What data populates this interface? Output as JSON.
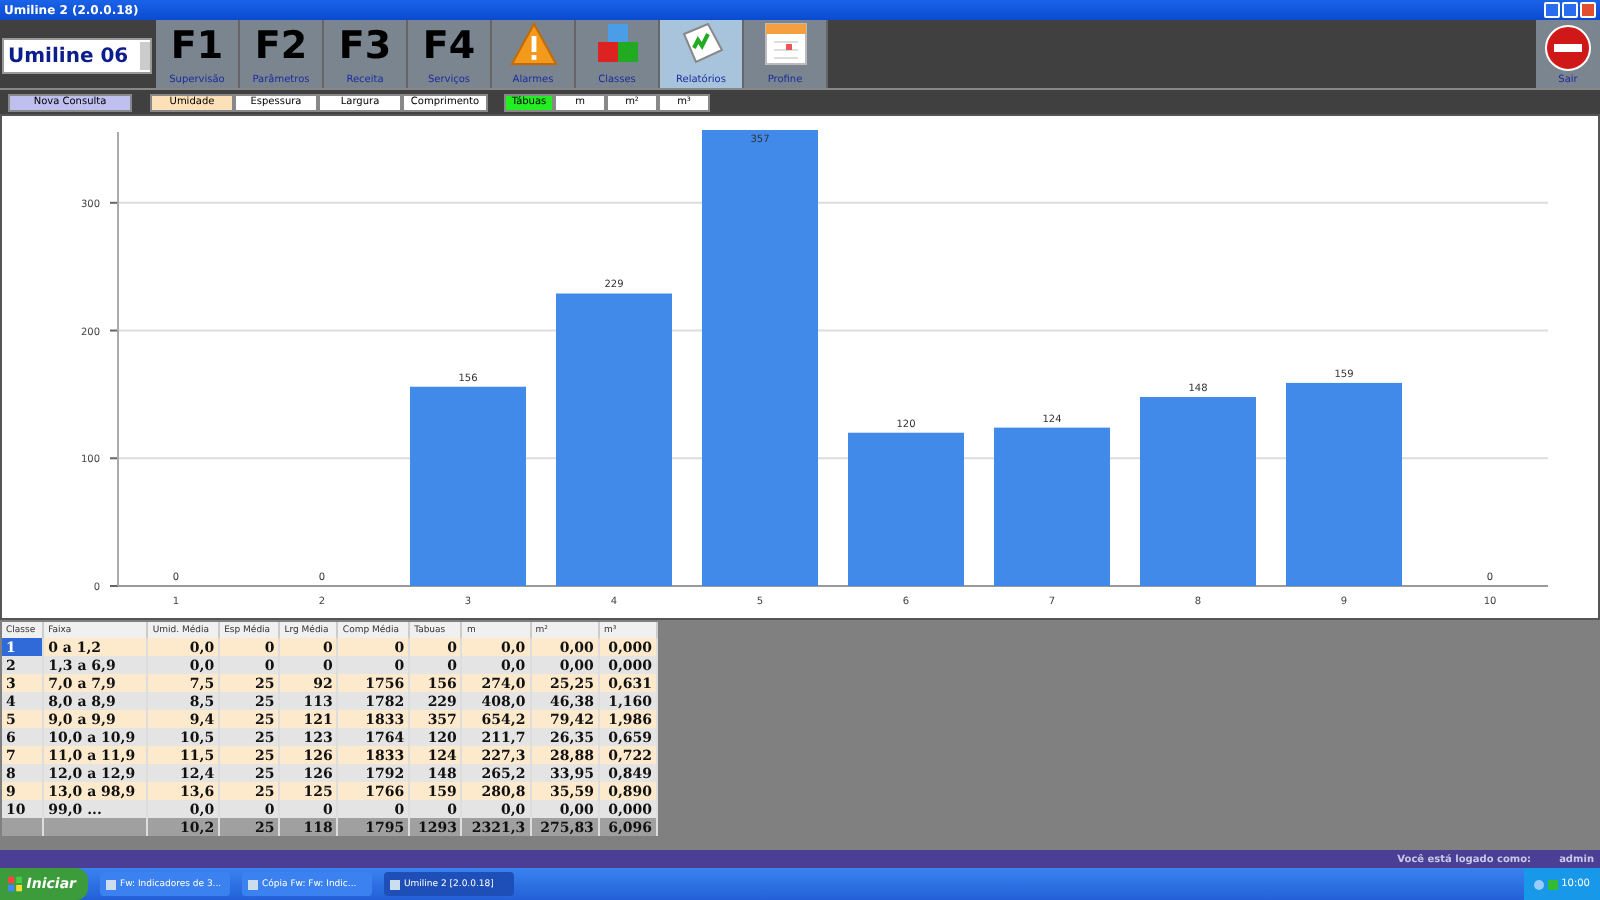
{
  "window": {
    "title": "Umiline 2 (2.0.0.18)"
  },
  "machine": {
    "value": "Umiline 06"
  },
  "toolbar": [
    {
      "kind": "key",
      "key": "F1",
      "label": "Supervisão",
      "selected": false
    },
    {
      "kind": "key",
      "key": "F2",
      "label": "Parâmetros",
      "selected": false
    },
    {
      "kind": "key",
      "key": "F3",
      "label": "Receita",
      "selected": false
    },
    {
      "kind": "key",
      "key": "F4",
      "label": "Serviços",
      "selected": false
    },
    {
      "kind": "warning",
      "label": "Alarmes",
      "selected": false
    },
    {
      "kind": "cubes",
      "label": "Classes",
      "selected": false
    },
    {
      "kind": "report",
      "label": "Relatórios",
      "selected": true
    },
    {
      "kind": "calendar",
      "label": "Profine",
      "selected": false
    }
  ],
  "exit_button": {
    "label": "Sair"
  },
  "new_query": "Nova Consulta",
  "measures": [
    {
      "label": "Umidade",
      "selected": true
    },
    {
      "label": "Espessura",
      "selected": false
    },
    {
      "label": "Largura",
      "selected": false
    },
    {
      "label": "Comprimento",
      "selected": false
    }
  ],
  "units": [
    {
      "label": "Tábuas",
      "selected": true
    },
    {
      "label": "m",
      "selected": false
    },
    {
      "label": "m²",
      "selected": false
    },
    {
      "label": "m³",
      "selected": false
    }
  ],
  "chart_data": {
    "type": "bar",
    "categories": [
      "1",
      "2",
      "3",
      "4",
      "5",
      "6",
      "7",
      "8",
      "9",
      "10"
    ],
    "series": [
      {
        "color": "#418aea",
        "values": [
          0,
          0,
          156,
          229,
          357,
          120,
          124,
          148,
          159,
          0
        ]
      }
    ],
    "ylim": [
      0,
      357
    ],
    "grid": true,
    "yticks": [
      0,
      100,
      200,
      300
    ],
    "data_labels": true
  },
  "table": {
    "columns": [
      "Classe",
      "Faixa",
      "Umid. Média",
      "Esp Média",
      "Lrg Média",
      "Comp Média",
      "Tabuas",
      "m",
      "m²",
      "m³"
    ],
    "rows": [
      {
        "selected": true,
        "cells": [
          "1",
          "0 a 1,2",
          "0,0",
          "0",
          "0",
          "0",
          "0",
          "0,0",
          "0,00",
          "0,000"
        ]
      },
      {
        "selected": false,
        "cells": [
          "2",
          "1,3 a 6,9",
          "0,0",
          "0",
          "0",
          "0",
          "0",
          "0,0",
          "0,00",
          "0,000"
        ]
      },
      {
        "selected": false,
        "cells": [
          "3",
          "7,0 a 7,9",
          "7,5",
          "25",
          "92",
          "1756",
          "156",
          "274,0",
          "25,25",
          "0,631"
        ]
      },
      {
        "selected": false,
        "cells": [
          "4",
          "8,0 a 8,9",
          "8,5",
          "25",
          "113",
          "1782",
          "229",
          "408,0",
          "46,38",
          "1,160"
        ]
      },
      {
        "selected": false,
        "cells": [
          "5",
          "9,0 a 9,9",
          "9,4",
          "25",
          "121",
          "1833",
          "357",
          "654,2",
          "79,42",
          "1,986"
        ]
      },
      {
        "selected": false,
        "cells": [
          "6",
          "10,0 a 10,9",
          "10,5",
          "25",
          "123",
          "1764",
          "120",
          "211,7",
          "26,35",
          "0,659"
        ]
      },
      {
        "selected": false,
        "cells": [
          "7",
          "11,0 a 11,9",
          "11,5",
          "25",
          "126",
          "1833",
          "124",
          "227,3",
          "28,88",
          "0,722"
        ]
      },
      {
        "selected": false,
        "cells": [
          "8",
          "12,0 a 12,9",
          "12,4",
          "25",
          "126",
          "1792",
          "148",
          "265,2",
          "33,95",
          "0,849"
        ]
      },
      {
        "selected": false,
        "cells": [
          "9",
          "13,0 a 98,9",
          "13,6",
          "25",
          "125",
          "1766",
          "159",
          "280,8",
          "35,59",
          "0,890"
        ]
      },
      {
        "selected": false,
        "cells": [
          "10",
          "99,0 ...",
          "0,0",
          "0",
          "0",
          "0",
          "0",
          "0,0",
          "0,00",
          "0,000"
        ]
      }
    ],
    "totals": [
      "10,2",
      "25",
      "118",
      "1795",
      "1293",
      "2321,3",
      "275,83",
      "6,096"
    ]
  },
  "status_bar": {
    "label": "Você está logado como:",
    "user": "admin"
  },
  "taskbar": {
    "start": "Iniciar",
    "tasks": [
      {
        "label": "Fw: Indicadores de 3...",
        "selected": false
      },
      {
        "label": "Cópia Fw: Fw: Indic...",
        "selected": false
      },
      {
        "label": "Umiline 2 [2.0.0.18]",
        "selected": true
      }
    ],
    "clock": "10:00"
  }
}
